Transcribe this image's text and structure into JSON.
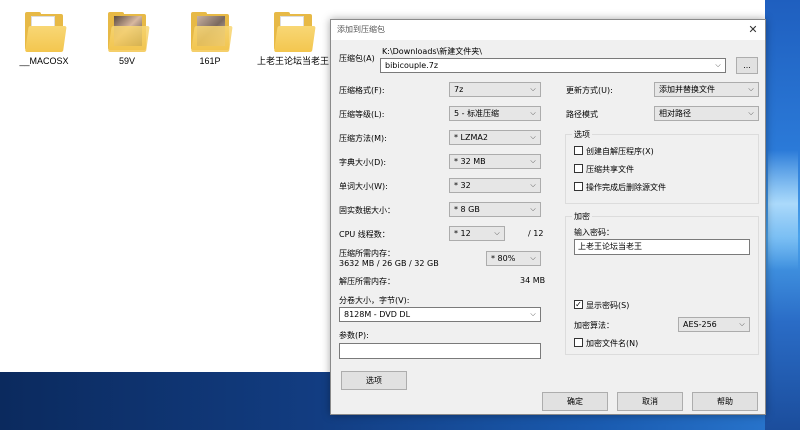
{
  "desktop": {
    "folders": [
      {
        "label": "__MACOSX",
        "thumb": "blank"
      },
      {
        "label": "59V",
        "thumb": "photo"
      },
      {
        "label": "161P",
        "thumb": "photo"
      },
      {
        "label": "上老王论坛当老王",
        "thumb": "blank"
      }
    ]
  },
  "dialog": {
    "title": "添加到压缩包",
    "close_glyph": "✕",
    "archive_label": "压缩包(A)",
    "archive_path": "K:\\Downloads\\新建文件夹\\",
    "archive_name": "bibicouple.7z",
    "browse_label": "...",
    "format_label": "压缩格式(F):",
    "format_value": "7z",
    "level_label": "压缩等级(L):",
    "level_value": "5 - 标准压缩",
    "method_label": "压缩方法(M):",
    "method_value": "* LZMA2",
    "dict_label": "字典大小(D):",
    "dict_value": "* 32 MB",
    "word_label": "单词大小(W):",
    "word_value": "* 32",
    "solid_label": "固实数据大小：",
    "solid_value": "* 8 GB",
    "cpu_label": "CPU 线程数：",
    "cpu_value": "* 12",
    "cpu_total": "/ 12",
    "mem_comp_label": "压缩所需内存：",
    "mem_comp_value": "3632 MB / 26 GB / 32 GB",
    "mem_pct_value": "* 80%",
    "mem_decomp_label": "解压所需内存：",
    "mem_decomp_value": "34 MB",
    "split_label": "分卷大小，字节(V):",
    "split_value": "8128M - DVD DL",
    "params_label": "参数(P):",
    "params_value": "",
    "options_button": "选项",
    "update_label": "更新方式(U):",
    "update_value": "添加并替换文件",
    "path_mode_label": "路径模式",
    "path_mode_value": "相对路径",
    "options_group_title": "选项",
    "opt_sfx": "创建自解压程序(X)",
    "opt_shared": "压缩共享文件",
    "opt_delete": "操作完成后删除源文件",
    "encrypt_group_title": "加密",
    "password_label": "输入密码：",
    "password_value": "上老王论坛当老王",
    "show_password": "显示密码(S)",
    "show_password_checked": true,
    "enc_method_label": "加密算法：",
    "enc_method_value": "AES-256",
    "encrypt_names": "加密文件名(N)",
    "ok_button": "确定",
    "cancel_button": "取消",
    "help_button": "帮助",
    "dropdown_glyph": "⌵",
    "check_glyph": "✓"
  }
}
